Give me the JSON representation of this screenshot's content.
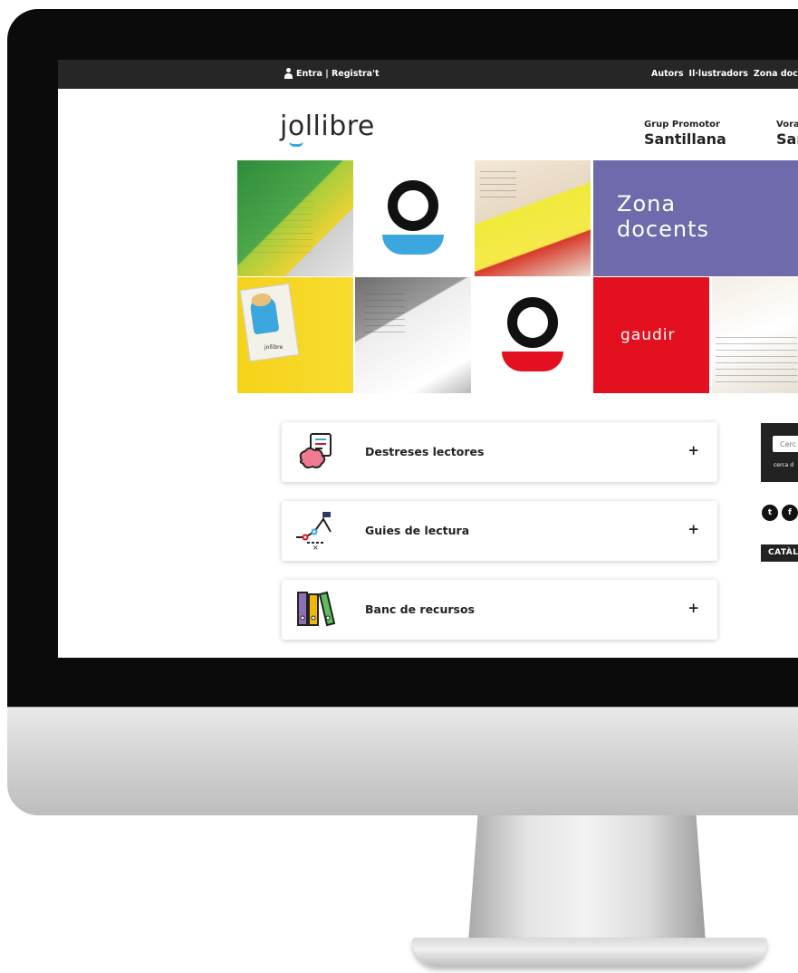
{
  "topbar": {
    "login_label": "Entra | Registra't",
    "nav": [
      "Autors",
      "Il·lustradors",
      "Zona doc"
    ]
  },
  "brand": {
    "logo": "jollibre"
  },
  "promoters": [
    {
      "small": "Grup Promotor",
      "big": "Santillana"
    },
    {
      "small": "Vora",
      "big": "Sar"
    }
  ],
  "tiles": {
    "zona": {
      "line1": "Zona",
      "line2": "docents"
    },
    "gaudir": "gaudir",
    "card_logo": "jollibre"
  },
  "accordion": [
    {
      "label": "Destreses lectores",
      "icon": "brain-reading-icon",
      "toggle": "+"
    },
    {
      "label": "Guies de lectura",
      "icon": "route-map-icon",
      "toggle": "+"
    },
    {
      "label": "Banc de recursos",
      "icon": "binders-icon",
      "toggle": "+"
    }
  ],
  "sidebar": {
    "search_placeholder": "Cerc",
    "search_caption": "cerca d",
    "social": [
      "twitter-icon",
      "facebook-icon"
    ],
    "catalog_label": "CATÀL"
  },
  "colors": {
    "topbar": "#262626",
    "accent_blue": "#3ba7de",
    "zona_purple": "#6e6aab",
    "gaudir_red": "#e3101f"
  }
}
